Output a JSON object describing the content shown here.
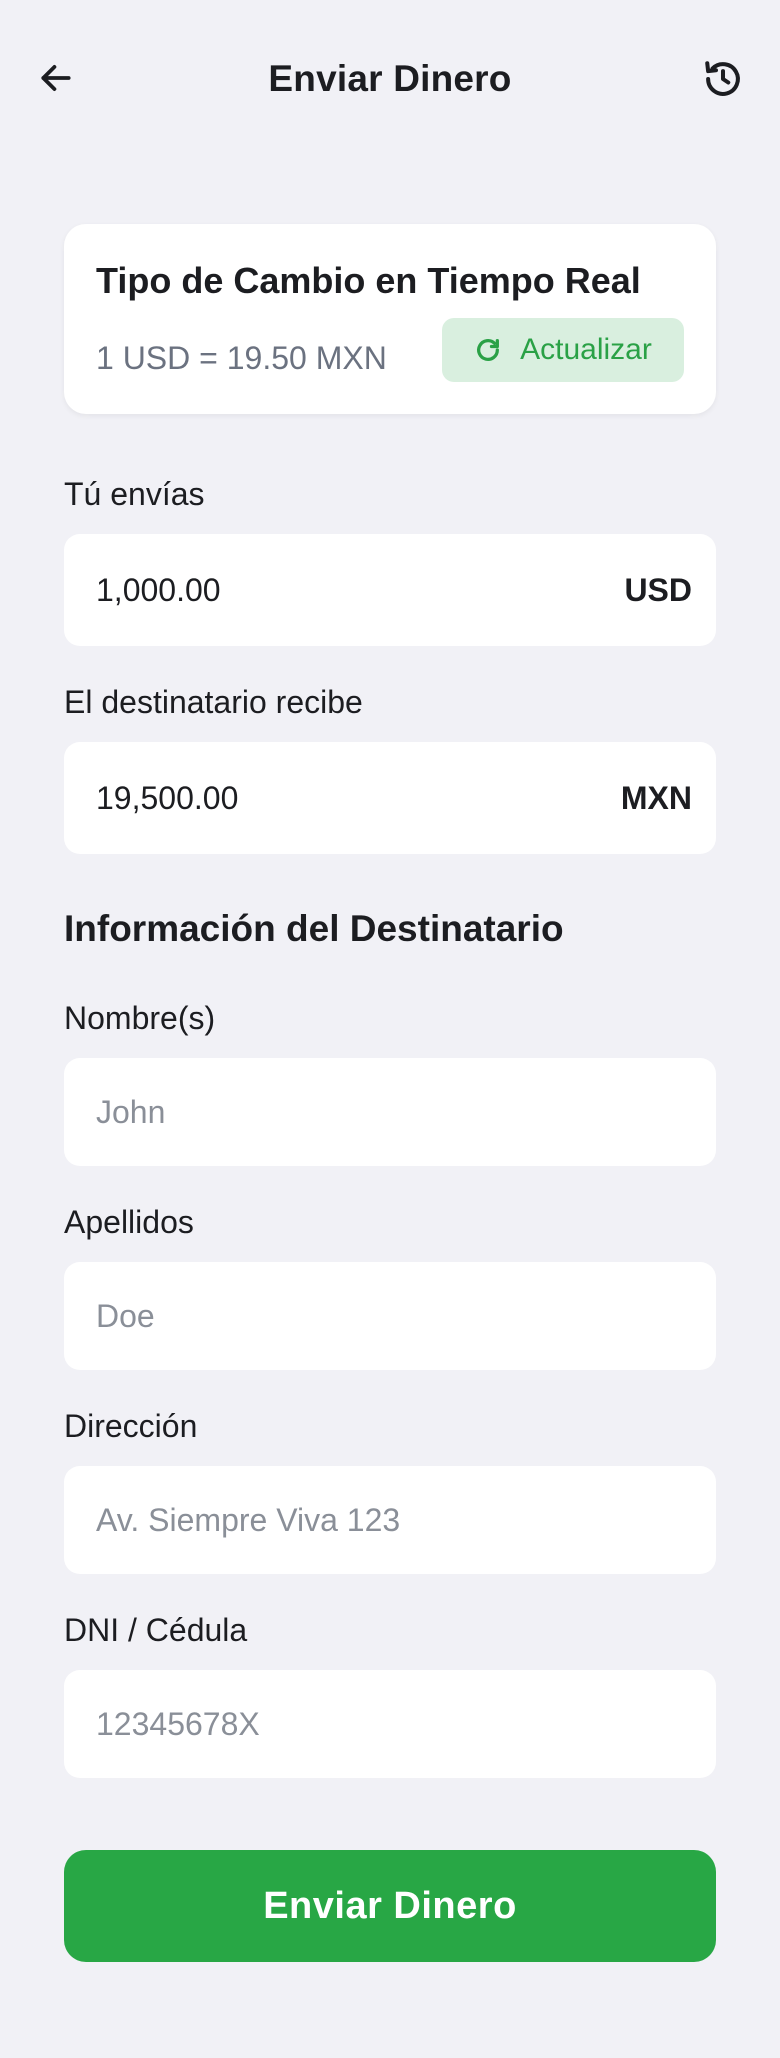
{
  "header": {
    "title": "Enviar Dinero",
    "back_icon": "arrow-left-icon",
    "history_icon": "history-icon"
  },
  "rate_card": {
    "title": "Tipo de Cambio en Tiempo Real",
    "rate_text": "1 USD = 19.50 MXN",
    "refresh_label": "Actualizar",
    "refresh_icon": "refresh-icon"
  },
  "send": {
    "label": "Tú envías",
    "amount": "1,000.00",
    "currency": "USD"
  },
  "receive": {
    "label": "El destinatario recibe",
    "amount": "19,500.00",
    "currency": "MXN"
  },
  "recipient": {
    "section_title": "Información del Destinatario",
    "first_name": {
      "label": "Nombre(s)",
      "placeholder": "John"
    },
    "last_name": {
      "label": "Apellidos",
      "placeholder": "Doe"
    },
    "address": {
      "label": "Dirección",
      "placeholder": "Av. Siempre Viva 123"
    },
    "id_number": {
      "label": "DNI / Cédula",
      "placeholder": "12345678X"
    }
  },
  "submit_label": "Enviar Dinero",
  "colors": {
    "background": "#f1f1f6",
    "primary": "#28a745",
    "refresh_bg": "#d9efdf",
    "refresh_text": "#2aa146",
    "muted_text": "#6b7280"
  }
}
